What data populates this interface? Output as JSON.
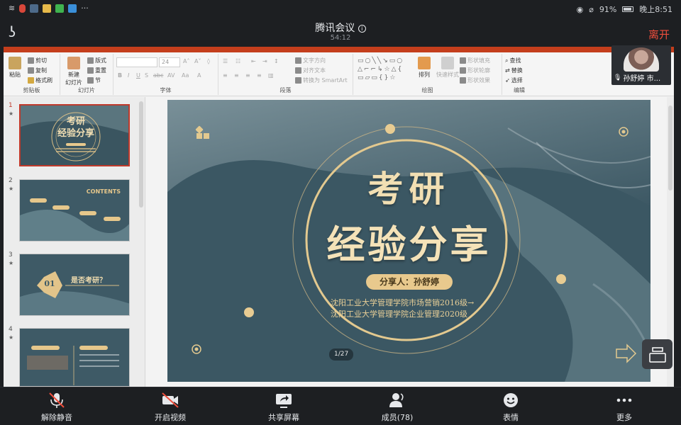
{
  "status": {
    "battery": "91%",
    "time": "晚上8:51"
  },
  "meeting": {
    "title": "腾讯会议",
    "timer": "54:12",
    "leave_label": "离开"
  },
  "ribbon": {
    "clipboard": {
      "paste": "粘贴",
      "cut": "剪切",
      "copy": "复制",
      "format_painter": "格式刷",
      "label": "剪贴板"
    },
    "slides": {
      "new_slide_line1": "新建",
      "new_slide_line2": "幻灯片",
      "layout": "版式",
      "reset": "重置",
      "section": "节",
      "label": "幻灯片"
    },
    "font": {
      "size": "24",
      "label": "字体"
    },
    "paragraph": {
      "text_direction": "文字方向",
      "align_text": "对齐文本",
      "smartart": "转换为 SmartArt",
      "label": "段落"
    },
    "drawing": {
      "arrange": "排列",
      "quick_styles": "快速样式",
      "shape_fill": "形状填充",
      "shape_outline": "形状轮廓",
      "shape_effects": "形状效果",
      "label": "绘图"
    },
    "editing": {
      "find": "查找",
      "replace": "替换",
      "select": "选择",
      "label": "编辑"
    }
  },
  "thumbnails": [
    {
      "num": "1",
      "star": "★",
      "title_line1": "考研",
      "title_line2": "经验分享"
    },
    {
      "num": "2",
      "star": "★",
      "heading": "CONTENTS"
    },
    {
      "num": "3",
      "star": "★",
      "badge": "01",
      "heading": "是否考研？"
    },
    {
      "num": "4",
      "star": "★"
    }
  ],
  "slide": {
    "title_line1": "考研",
    "title_line2": "经验分享",
    "presenter": "分享人：孙舒婷",
    "line1": "沈阳工业大学管理学院市场营销2016级→",
    "line2": "沈阳工业大学管理学院企业管理2020级",
    "page": "1/27"
  },
  "video": {
    "name": "孙舒婷 市..."
  },
  "bottom": {
    "unmute": "解除静音",
    "video": "开启视频",
    "share": "共享屏幕",
    "members": "成员(78)",
    "reactions": "表情",
    "more": "更多"
  },
  "colors": {
    "leave": "#ef4e3c",
    "accent": "#c43e1c",
    "gold": "#e8c98d",
    "slide_bg": "#3c5864"
  }
}
